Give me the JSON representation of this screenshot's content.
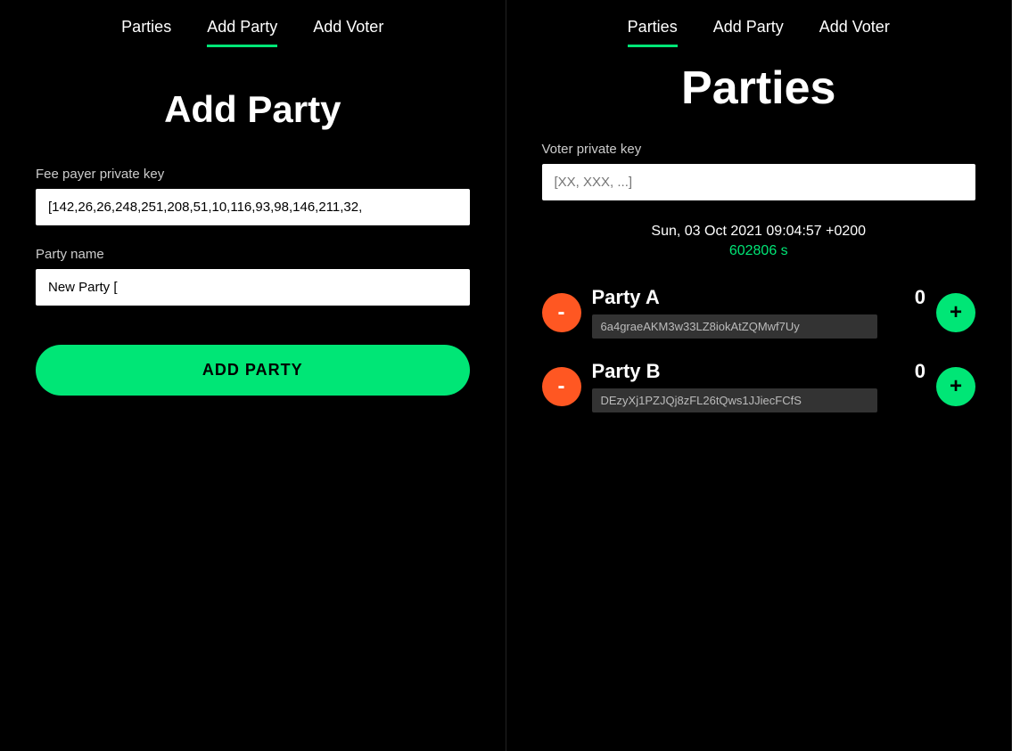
{
  "left": {
    "nav": {
      "items": [
        {
          "label": "Parties",
          "active": false
        },
        {
          "label": "Add Party",
          "active": true
        },
        {
          "label": "Add Voter",
          "active": false
        }
      ]
    },
    "title": "Add Party",
    "fee_payer_label": "Fee payer private key",
    "fee_payer_value": "[142,26,26,248,251,208,51,10,116,93,98,146,211,32,",
    "party_name_label": "Party name",
    "party_name_placeholder": "New Party",
    "party_name_value": "New Party [",
    "add_party_button": "ADD PARTY"
  },
  "right": {
    "nav": {
      "items": [
        {
          "label": "Parties",
          "active": true
        },
        {
          "label": "Add Party",
          "active": false
        },
        {
          "label": "Add Voter",
          "active": false
        }
      ]
    },
    "title": "Parties",
    "voter_key_label": "Voter private key",
    "voter_key_placeholder": "[XX, XXX, ...]",
    "datetime": "Sun, 03 Oct 2021 09:04:57 +0200",
    "elapsed": "602806 s",
    "parties": [
      {
        "name": "Party A",
        "votes": "0",
        "address": "6a4graeAKM3w33LZ8iokAtZQMwf7Uy"
      },
      {
        "name": "Party B",
        "votes": "0",
        "address": "DEzyXj1PZJQj8zFL26tQws1JJiecFCfS"
      }
    ]
  },
  "icons": {
    "minus": "-",
    "plus": "+"
  }
}
